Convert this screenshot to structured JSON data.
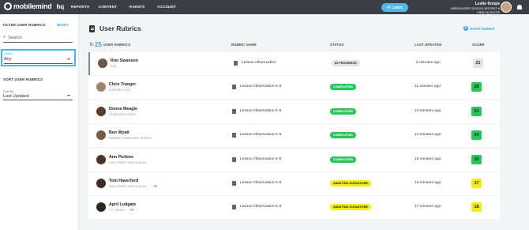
{
  "topbar": {
    "logo_text": "mobilemind",
    "logo_suffix": "hq",
    "nav": [
      "REPORTS",
      "CONTENT",
      "EVENTS",
      "ACCOUNT"
    ],
    "learn_label": "Learn",
    "user_name": "Leslie Knope",
    "user_district": "GREEN ACRES SCHOOL DISTRICT",
    "user_role": "VIEW HQ ROLES"
  },
  "sidebar": {
    "filter_title": "FILTER USER RUBRICS",
    "reset_label": "RESET",
    "search_placeholder": "Search",
    "status_label": "Status",
    "status_value": "Any",
    "sort_title": "SORT USER RUBRICS",
    "sortby_label": "Sort By",
    "sortby_value": "Last Updated"
  },
  "main": {
    "title": "User Rubrics",
    "start_label": "START RUBRIC",
    "count": "25",
    "headers": {
      "user": "USER RUBRICS",
      "rubric": "RUBRIC NAME",
      "status": "STATUS",
      "updated": "LAST UPDATED",
      "score": "SCORE"
    },
    "rows": [
      {
        "name": "Ron Swanson",
        "sub": "PUB",
        "plus": "",
        "rubric": "Lesson Observation",
        "status": "IN PROGRESS",
        "time": "6 minutes ago",
        "score": "21"
      },
      {
        "name": "Chris Traeger",
        "sub": "SUB DIRECTIVE",
        "plus": "",
        "rubric": "Lesson Observation K-5",
        "status": "COMPLETED",
        "time": "11 minutes ago",
        "score": "28"
      },
      {
        "name": "Donna Meagle",
        "sub": "*CLASSIFIED STAFF",
        "plus": "",
        "rubric": "Lesson Observation K-5",
        "status": "COMPLETED",
        "time": "13 minutes ago",
        "score": "21"
      },
      {
        "name": "Ben Wyatt",
        "sub": "PAWNEE ELEMENTARY SCHOOL",
        "plus": "",
        "rubric": "Lesson Observation K-5",
        "status": "COMPLETED",
        "time": "14 minutes ago",
        "score": "24"
      },
      {
        "name": "Ann Perkins",
        "sub": "OAK STREET HIGH SCHOOL",
        "plus": "",
        "rubric": "Lesson Observation K-5",
        "status": "COMPLETED",
        "time": "15 minutes ago",
        "score": "20"
      },
      {
        "name": "Tom Haverford",
        "sub": "OAK STREET HIGH SCHOOL",
        "plus": "+5",
        "rubric": "Lesson Observation K-5",
        "status": "AWAITING SIGNATURE",
        "time": "16 minutes ago",
        "score": "17"
      },
      {
        "name": "April Ludgate",
        "sub": "*TC GROUP",
        "plus": "+6",
        "rubric": "Lesson Observation K-5",
        "status": "AWAITING SIGNATURE",
        "time": "17 minutes ago",
        "score": "18"
      }
    ]
  }
}
